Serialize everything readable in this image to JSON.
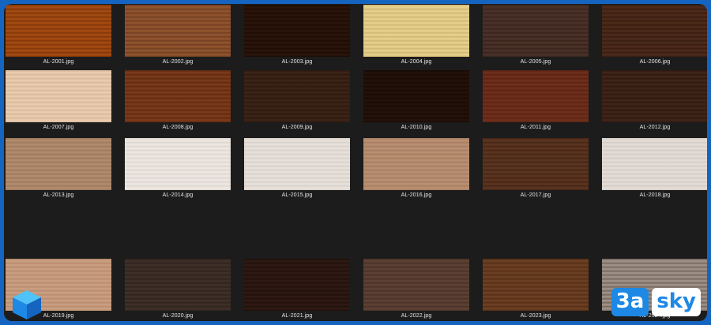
{
  "gallery": {
    "tiles": [
      {
        "filename": "AL-2001.jpg",
        "color": "#a24a12",
        "grain": "#7e3206"
      },
      {
        "filename": "AL-2002.jpg",
        "color": "#8f532e",
        "grain": "#6e3c20"
      },
      {
        "filename": "AL-2003.jpg",
        "color": "#2a140a",
        "grain": "#1a0a04"
      },
      {
        "filename": "AL-2004.jpg",
        "color": "#e4cf8c",
        "grain": "#cdb46f"
      },
      {
        "filename": "AL-2005.jpg",
        "color": "#4a3128",
        "grain": "#36221b"
      },
      {
        "filename": "AL-2006.jpg",
        "color": "#4b2a1a",
        "grain": "#351b0f"
      },
      {
        "filename": "AL-2007.jpg",
        "color": "#e8cbb0",
        "grain": "#d7b596"
      },
      {
        "filename": "AL-2008.jpg",
        "color": "#7a3a19",
        "grain": "#5c280e"
      },
      {
        "filename": "AL-2009.jpg",
        "color": "#3b2317",
        "grain": "#2a170d"
      },
      {
        "filename": "AL-2010.jpg",
        "color": "#23110a",
        "grain": "#150904"
      },
      {
        "filename": "AL-2011.jpg",
        "color": "#6f2e1c",
        "grain": "#572011"
      },
      {
        "filename": "AL-2012.jpg",
        "color": "#3f2419",
        "grain": "#2c170f"
      },
      {
        "filename": "AL-2013.jpg",
        "color": "#b08b6d",
        "grain": "#9a7557"
      },
      {
        "filename": "AL-2014.jpg",
        "color": "#ece6e1",
        "grain": "#ddd4cd"
      },
      {
        "filename": "AL-2015.jpg",
        "color": "#e6e0da",
        "grain": "#d6cec6"
      },
      {
        "filename": "AL-2016.jpg",
        "color": "#b98f73",
        "grain": "#a57a5d"
      },
      {
        "filename": "AL-2017.jpg",
        "color": "#5a3420",
        "grain": "#432313"
      },
      {
        "filename": "AL-2018.jpg",
        "color": "#e3dcd6",
        "grain": "#d2c9c1"
      },
      {
        "filename": "AL-2019.jpg",
        "color": "#c99e80",
        "grain": "#b5886a"
      },
      {
        "filename": "AL-2020.jpg",
        "color": "#3e3028",
        "grain": "#2d211a"
      },
      {
        "filename": "AL-2021.jpg",
        "color": "#2e1913",
        "grain": "#1f0f0a"
      },
      {
        "filename": "AL-2022.jpg",
        "color": "#5d4034",
        "grain": "#473025"
      },
      {
        "filename": "AL-2023.jpg",
        "color": "#6b3f22",
        "grain": "#522d15"
      },
      {
        "filename": "AL-2024.jpg",
        "color": "#9d8f85",
        "grain": "#6f6158"
      }
    ]
  },
  "branding": {
    "logo_icon": "cube-icon",
    "brand_part_a": "3a",
    "brand_part_b": "sky",
    "brand_color": "#1e88e5"
  }
}
